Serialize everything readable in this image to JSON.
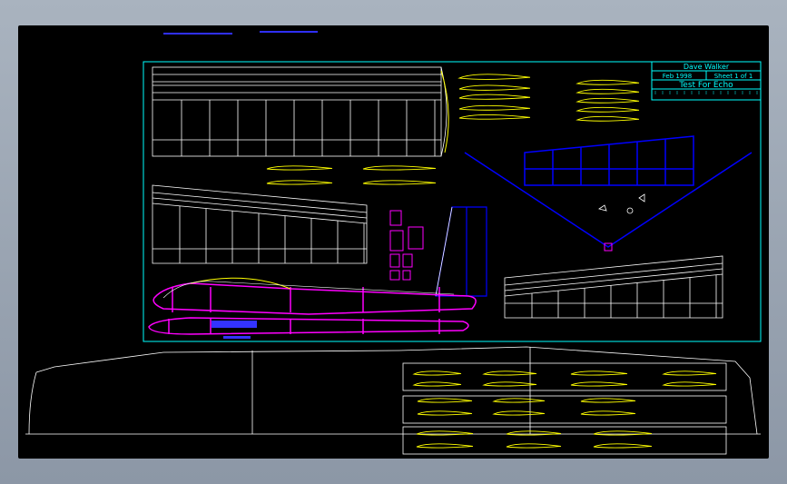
{
  "title_block": {
    "author": "Dave Walker",
    "date": "Feb 1998",
    "sheet": "Sheet 1 of 1",
    "title": "Test For Echo"
  },
  "colors": {
    "viewport_bg": "#000000",
    "sheet_border": "#00ffff",
    "wing_lines": "#ffffff",
    "airfoils": "#ffff00",
    "fuselage": "#ff00ff",
    "stab": "#0000ff"
  }
}
